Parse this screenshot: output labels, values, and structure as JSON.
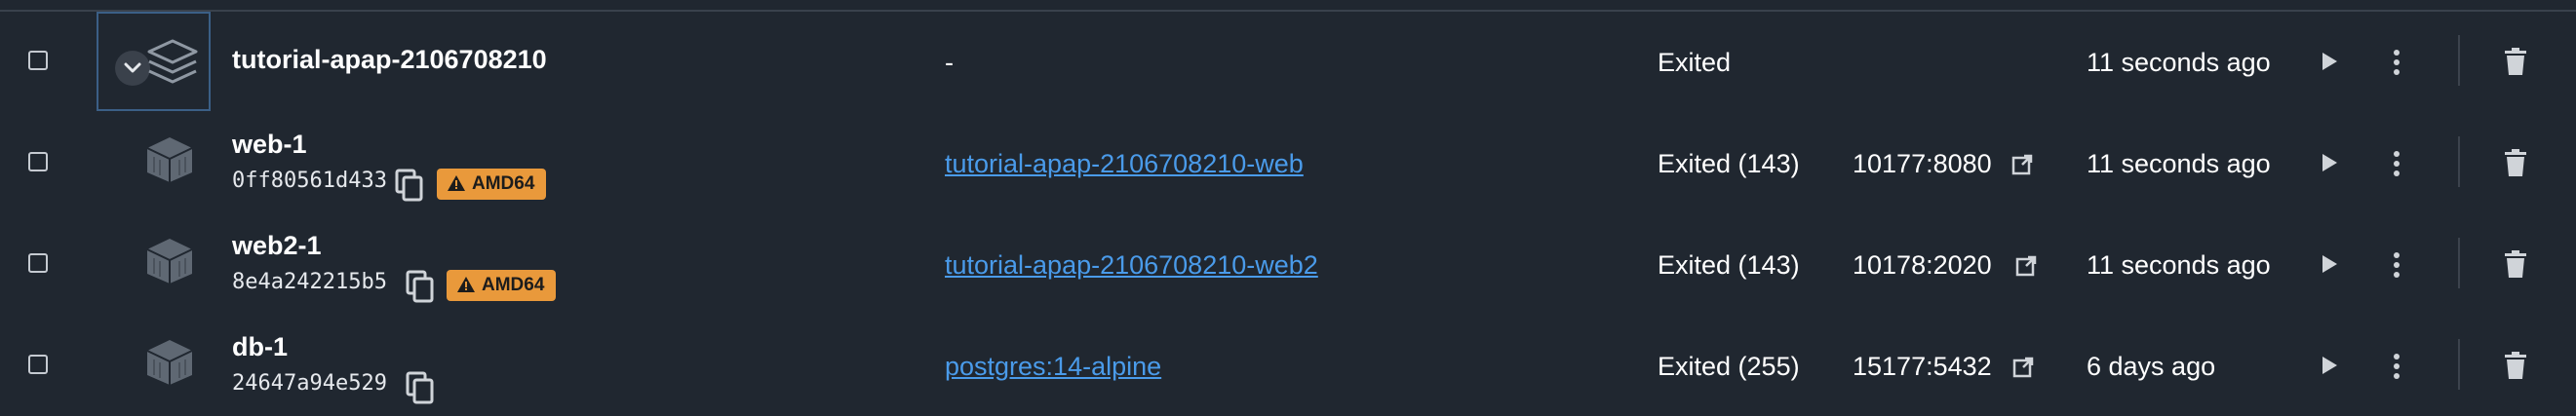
{
  "rows": [
    {
      "name": "tutorial-apap-2106708210",
      "image": "-",
      "status": "Exited",
      "port": "",
      "time": "11 seconds ago"
    },
    {
      "name": "web-1",
      "container_id": "0ff80561d433",
      "badge": "AMD64",
      "image": "tutorial-apap-2106708210-web",
      "status": "Exited (143)",
      "port": "10177:8080",
      "time": "11 seconds ago"
    },
    {
      "name": "web2-1",
      "container_id": "8e4a242215b5",
      "badge": "AMD64",
      "image": "tutorial-apap-2106708210-web2",
      "status": "Exited (143)",
      "port": "10178:2020",
      "time": "11 seconds ago"
    },
    {
      "name": "db-1",
      "container_id": "24647a94e529",
      "image": "postgres:14-alpine",
      "status": "Exited (255)",
      "port": "15177:5432",
      "time": "6 days ago"
    }
  ],
  "icons": {
    "stack": "layers-icon",
    "container": "container-cube-icon",
    "copy": "copy-icon",
    "warning": "warning-triangle-icon",
    "external": "external-link-icon",
    "play": "play-icon",
    "more": "kebab-menu-icon",
    "delete": "trash-icon",
    "expand": "chevron-down-icon"
  },
  "colors": {
    "background": "#202730",
    "link": "#4a9bea",
    "badge": "#e9993b",
    "selected_border": "#3b5f86"
  }
}
